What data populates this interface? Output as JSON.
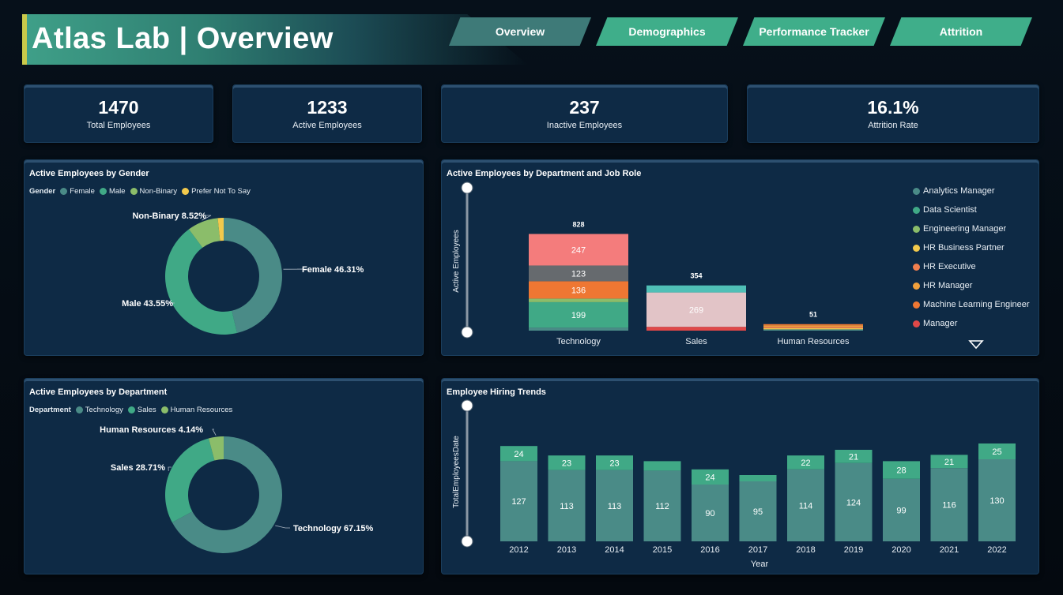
{
  "header": {
    "title": "Atlas Lab | Overview"
  },
  "nav": [
    {
      "label": "Overview",
      "active": true
    },
    {
      "label": "Demographics",
      "active": false
    },
    {
      "label": "Performance Tracker",
      "active": false
    },
    {
      "label": "Attrition",
      "active": false
    }
  ],
  "kpis": [
    {
      "value": "1470",
      "label": "Total Employees"
    },
    {
      "value": "1233",
      "label": "Active Employees"
    },
    {
      "value": "237",
      "label": "Inactive Employees"
    },
    {
      "value": "16.1%",
      "label": "Attrition Rate"
    }
  ],
  "colors": {
    "female": "#4a8b87",
    "male": "#40a986",
    "nonbinary": "#8bbd6a",
    "prefer": "#f2c94c"
  },
  "gender_panel": {
    "title": "Active Employees by Gender",
    "legend_title": "Gender",
    "legend": [
      "Female",
      "Male",
      "Non-Binary",
      "Prefer Not To Say"
    ]
  },
  "dept_panel": {
    "title": "Active Employees by Department",
    "legend_title": "Department",
    "legend": [
      "Technology",
      "Sales",
      "Human Resources"
    ]
  },
  "role_panel": {
    "title": "Active Employees by Department and Job Role",
    "y_axis": "Active Employees",
    "legend": [
      {
        "name": "Analytics Manager",
        "color": "#4a8b87"
      },
      {
        "name": "Data Scientist",
        "color": "#40a986"
      },
      {
        "name": "Engineering Manager",
        "color": "#8bbd6a"
      },
      {
        "name": "HR Business Partner",
        "color": "#f2c94c"
      },
      {
        "name": "HR Executive",
        "color": "#f07f4e"
      },
      {
        "name": "HR Manager",
        "color": "#f0a03c"
      },
      {
        "name": "Machine Learning Engineer",
        "color": "#ee7733"
      },
      {
        "name": "Manager",
        "color": "#e04848"
      }
    ]
  },
  "trend_panel": {
    "title": "Employee Hiring Trends",
    "y_axis": "TotalEmployeesDate",
    "x_axis": "Year"
  },
  "chart_data": [
    {
      "type": "pie",
      "title": "Active Employees by Gender",
      "categories": [
        "Female",
        "Male",
        "Non-Binary",
        "Prefer Not To Say"
      ],
      "values": [
        46.31,
        43.55,
        8.52,
        1.62
      ],
      "data_labels": [
        "Female 46.31%",
        "Male 43.55%",
        "Non-Binary 8.52%",
        ""
      ]
    },
    {
      "type": "bar",
      "title": "Active Employees by Department and Job Role",
      "ylabel": "Active Employees",
      "categories": [
        "Technology",
        "Sales",
        "Human Resources"
      ],
      "totals": [
        828,
        354,
        51
      ],
      "series": [
        {
          "color": "#4a8b87",
          "values": [
            24,
            0,
            10
          ]
        },
        {
          "color": "#40a986",
          "values": [
            199,
            0,
            0
          ]
        },
        {
          "color": "#8bbd6a",
          "values": [
            28,
            0,
            0
          ]
        },
        {
          "color": "#f2c94c",
          "values": [
            0,
            0,
            10
          ]
        },
        {
          "color": "#f07f4e",
          "values": [
            0,
            0,
            11
          ]
        },
        {
          "color": "#f0a03c",
          "values": [
            0,
            0,
            10
          ]
        },
        {
          "color": "#ee7733",
          "values": [
            136,
            0,
            10
          ]
        },
        {
          "color": "#e04848",
          "values": [
            0,
            30,
            0
          ]
        },
        {
          "color": "#e2c4c7",
          "values": [
            0,
            269,
            0
          ]
        },
        {
          "color": "#4fbfb6",
          "values": [
            0,
            55,
            0
          ]
        },
        {
          "color": "#666a6e",
          "values": [
            123,
            0,
            0
          ]
        },
        {
          "color": "#f47c7c",
          "values": [
            247,
            0,
            0
          ]
        }
      ],
      "labels": [
        [
          "",
          "199",
          "",
          "",
          "",
          "",
          "136",
          "",
          "",
          "",
          "123",
          "247"
        ],
        [
          "",
          "",
          "",
          "",
          "",
          "",
          "",
          "",
          "269",
          "",
          "",
          ""
        ],
        [
          "",
          "",
          "",
          "",
          "",
          "",
          "",
          "",
          "",
          "",
          "",
          ""
        ]
      ]
    },
    {
      "type": "pie",
      "title": "Active Employees by Department",
      "categories": [
        "Technology",
        "Sales",
        "Human Resources"
      ],
      "values": [
        67.15,
        28.71,
        4.14
      ],
      "data_labels": [
        "Technology 67.15%",
        "Sales 28.71%",
        "Human Resources 4.14%"
      ]
    },
    {
      "type": "bar",
      "title": "Employee Hiring Trends",
      "xlabel": "Year",
      "ylabel": "TotalEmployeesDate",
      "categories": [
        "2012",
        "2013",
        "2014",
        "2015",
        "2016",
        "2017",
        "2018",
        "2019",
        "2020",
        "2021",
        "2022"
      ],
      "series": [
        {
          "color": "#4a8b87",
          "values": [
            127,
            113,
            113,
            112,
            90,
            95,
            114,
            124,
            99,
            116,
            130
          ],
          "labels": [
            "127",
            "113",
            "113",
            "112",
            "90",
            "95",
            "114",
            "124",
            "99",
            "116",
            "130"
          ]
        },
        {
          "color": "#40a986",
          "values": [
            24,
            23,
            23,
            15,
            24,
            10,
            22,
            21,
            28,
            21,
            25
          ],
          "labels": [
            "24",
            "23",
            "23",
            "",
            "24",
            "",
            "22",
            "21",
            "28",
            "21",
            "25"
          ]
        }
      ]
    }
  ]
}
